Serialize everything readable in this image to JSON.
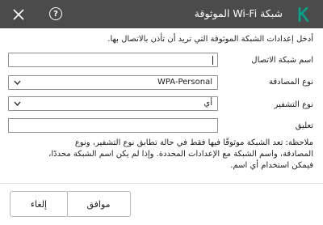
{
  "header": {
    "title": "شبكة Wi-Fi الموثوقة",
    "help_glyph": "?",
    "logo_letter": "K",
    "background_color": "#4b4b4b",
    "logo_color": "#00a88e"
  },
  "intro_text": "أدخل إعدادات الشبكة الموثوقة التي تريد أن تأذن بالاتصال بها.",
  "form": {
    "network_name": {
      "label": "اسم شبكة الاتصال",
      "value": ""
    },
    "auth_type": {
      "label": "نوع المصادقة",
      "selected": "WPA-Personal"
    },
    "encryption_type": {
      "label": "نوع التشفير",
      "selected": "أي"
    },
    "comment": {
      "label": "تعليق",
      "value": ""
    }
  },
  "note_lines": [
    "ملاحظة: تعد الشبكة موثوقًا فيها فقط في حالة تطابق نوع التشفير، ونوع",
    "المصادقة، واسم الشبكة مع الإعدادات المحددة. وإذا لم يكن اسم الشبكة محددًا،",
    "فيمكن استخدام أي اسم."
  ],
  "footer": {
    "ok_label": "موافق",
    "cancel_label": "إلغاء"
  }
}
